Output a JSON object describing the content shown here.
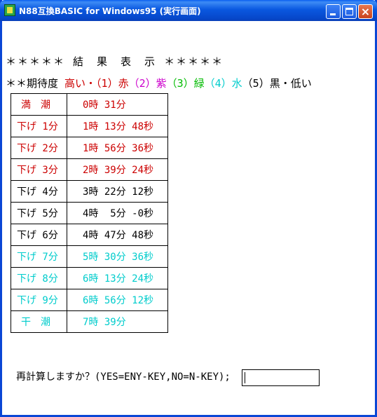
{
  "window": {
    "title": "N88互換BASIC for Windows95 (実行画面)",
    "close_glyph": "×"
  },
  "screen": {
    "heading": "＊＊＊＊＊ 結　果　表　示 ＊＊＊＊＊",
    "legend": {
      "prefix": "＊＊期待度",
      "items": [
        {
          "text": " 高い・（1）赤",
          "color": "#cc0000"
        },
        {
          "text": "（2）紫",
          "color": "#cc00cc"
        },
        {
          "text": "（3）緑",
          "color": "#00bb00"
        },
        {
          "text": "（4）水",
          "color": "#00cccc"
        },
        {
          "text": "（5）黒・低い",
          "color": "#000000"
        }
      ]
    },
    "rows": [
      {
        "label": "満　潮",
        "time": "0時 31分",
        "color": "#cc0000"
      },
      {
        "label": "下げ 1分",
        "time": "1時 13分 48秒",
        "color": "#cc0000"
      },
      {
        "label": "下げ 2分",
        "time": "1時 56分 36秒",
        "color": "#cc0000"
      },
      {
        "label": "下げ 3分",
        "time": "2時 39分 24秒",
        "color": "#cc0000"
      },
      {
        "label": "下げ 4分",
        "time": "3時 22分 12秒",
        "color": "#000000"
      },
      {
        "label": "下げ 5分",
        "time": "4時  5分 -0秒",
        "color": "#000000"
      },
      {
        "label": "下げ 6分",
        "time": "4時 47分 48秒",
        "color": "#000000"
      },
      {
        "label": "下げ 7分",
        "time": "5時 30分 36秒",
        "color": "#00cccc"
      },
      {
        "label": "下げ 8分",
        "time": "6時 13分 24秒",
        "color": "#00cccc"
      },
      {
        "label": "下げ 9分",
        "time": "6時 56分 12秒",
        "color": "#00cccc"
      },
      {
        "label": "干　潮",
        "time": "7時 39分",
        "color": "#00cccc"
      }
    ],
    "prompt": "再計算しますか？(YES=ENY-KEY,NO=N-KEY);",
    "input_value": ""
  }
}
